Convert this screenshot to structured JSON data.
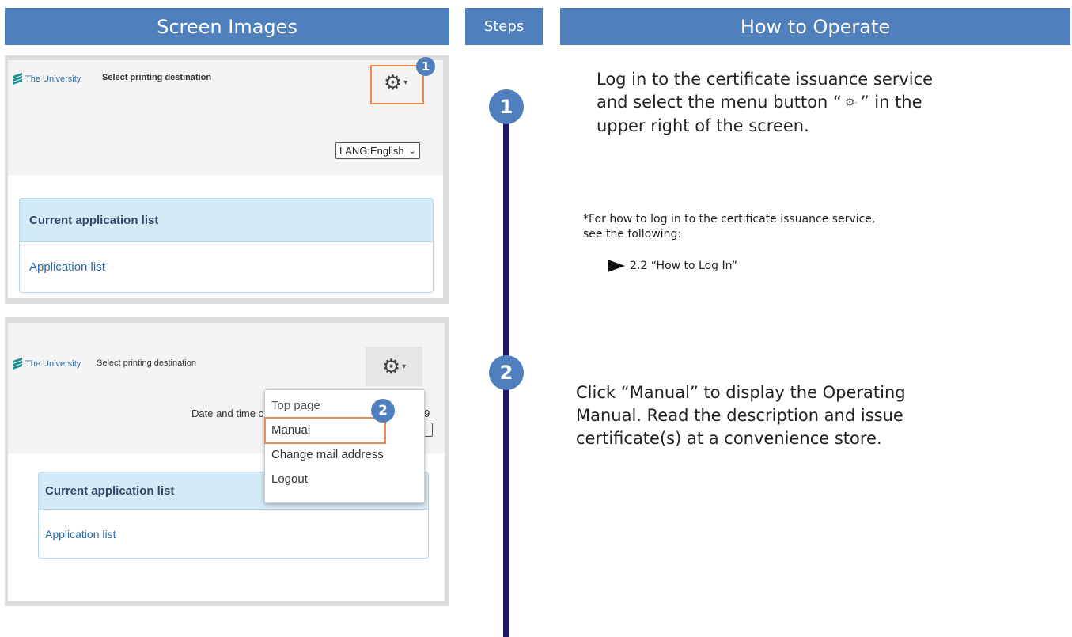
{
  "headers": {
    "screen_images": "Screen Images",
    "steps": "Steps",
    "how_to_operate": "How to Operate"
  },
  "screen1": {
    "logo_text": "The University",
    "page_title": "Select printing destination",
    "badge": "1",
    "lang_select": "LANG:English",
    "panel_title": "Current application list",
    "panel_link": "Application list"
  },
  "screen2": {
    "logo_text": "The University",
    "page_title": "Select printing destination",
    "date_text": "Date and time c",
    "date_tail": "9",
    "badge": "2",
    "menu": [
      "Top page",
      "Manual",
      "Change mail address",
      "Logout"
    ],
    "panel_title": "Current application list",
    "panel_link": "Application list"
  },
  "steps": [
    "1",
    "2"
  ],
  "operate": {
    "step1_line1": "Log in to the certificate issuance service",
    "step1_line2a": "and select the menu button “",
    "step1_line2b": "” in the",
    "step1_line3": "upper right of the screen.",
    "note_line1": "*For how to log in to the certificate issuance service,",
    "note_line2": "see the following:",
    "note_link": "2.2 “How to Log In”",
    "step2_line1": "Click “Manual” to display the Operating",
    "step2_line2": "Manual. Read the description and issue",
    "step2_line3": "certificate(s) at a convenience store."
  },
  "icons": {
    "gear": "gear-icon",
    "caret": "chevron-down-icon",
    "arrow": "arrow-right-icon"
  },
  "colors": {
    "header_blue": "#4f7fbc",
    "step_line": "#1e1a6b",
    "highlight": "#f08c4c",
    "panel_head": "#d4eaf6"
  }
}
